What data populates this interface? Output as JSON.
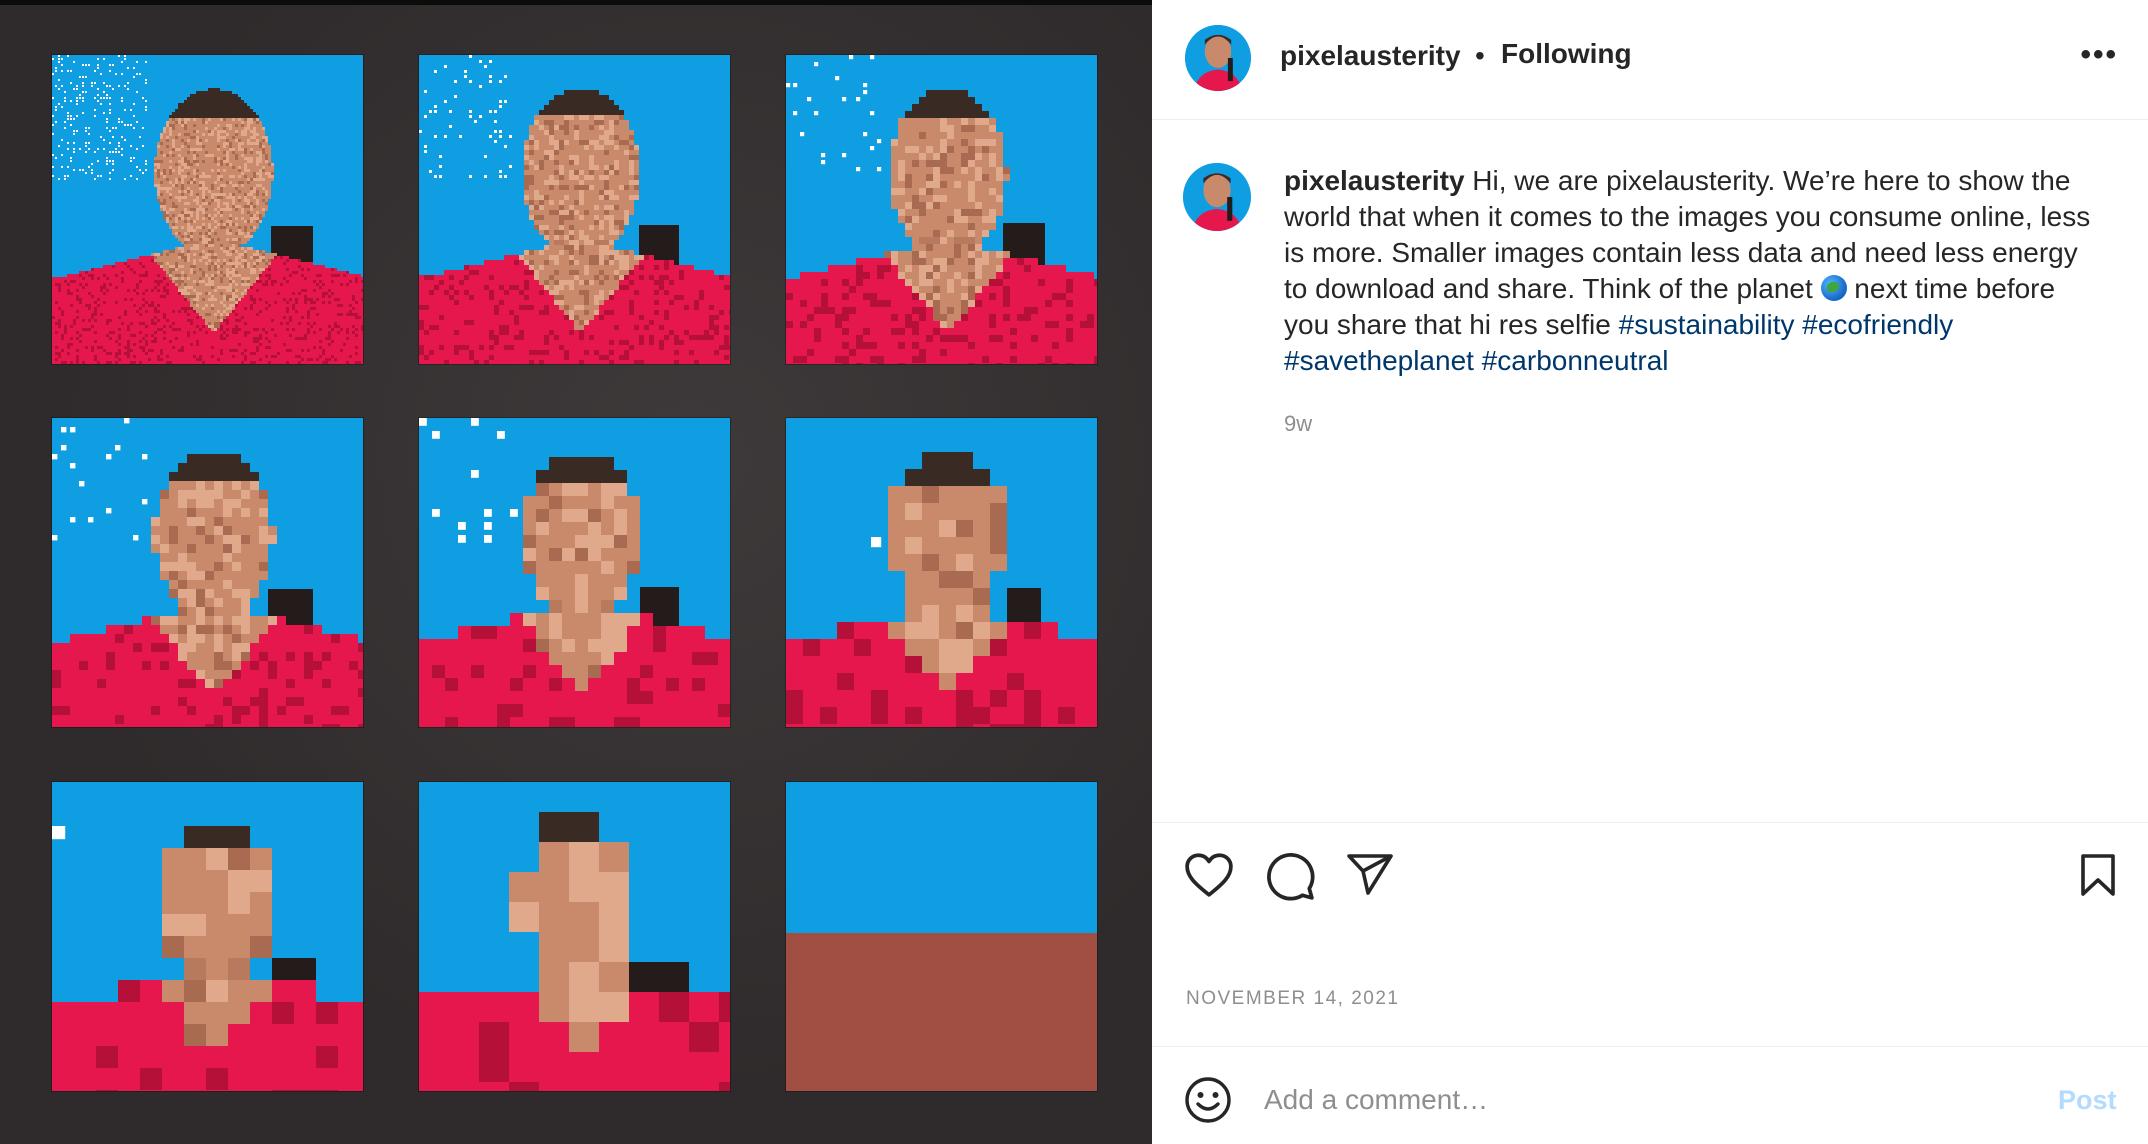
{
  "post": {
    "username": "pixelausterity",
    "separator": "•",
    "follow_status": "Following",
    "more_label": "•••",
    "caption": {
      "username": "pixelausterity",
      "text_1": " Hi, we are pixelausterity. We’re here to show the world that when it comes to the images you consume online, less is more. Smaller images contain less data and need less energy to download and share. Think of the planet ",
      "text_2": " next time before you share that hi res selfie ",
      "hashtags": [
        "#sustainability",
        "#ecofriendly",
        "#savetheplanet",
        "#carbonneutral"
      ]
    },
    "time_ago": "9w",
    "date": "NOVEMBER 14, 2021",
    "comment_placeholder": "Add a comment…",
    "post_button": "Post"
  },
  "icons": {
    "like": "heart-icon",
    "comment": "comment-bubble-icon",
    "share": "paper-plane-icon",
    "save": "bookmark-icon",
    "emoji": "smiley-icon",
    "globe": "globe-emoji-icon"
  },
  "colors": {
    "tile_blue": "#0f9ee2",
    "shirt_red": "#e5174d",
    "skin": "#c98a6c",
    "media_bg": "#2f2b2c",
    "hashtag": "#00376b",
    "post_disabled": "#b3dbff"
  },
  "media": {
    "tiles": [
      {
        "label": "pixelation-step-1",
        "level": 1
      },
      {
        "label": "pixelation-step-2",
        "level": 2
      },
      {
        "label": "pixelation-step-3",
        "level": 3
      },
      {
        "label": "pixelation-step-4",
        "level": 4
      },
      {
        "label": "pixelation-step-5",
        "level": 5
      },
      {
        "label": "pixelation-step-6",
        "level": 6
      },
      {
        "label": "pixelation-step-7",
        "level": 7
      },
      {
        "label": "pixelation-step-8",
        "level": 8
      },
      {
        "label": "pixelation-step-9",
        "level": 9
      }
    ]
  }
}
